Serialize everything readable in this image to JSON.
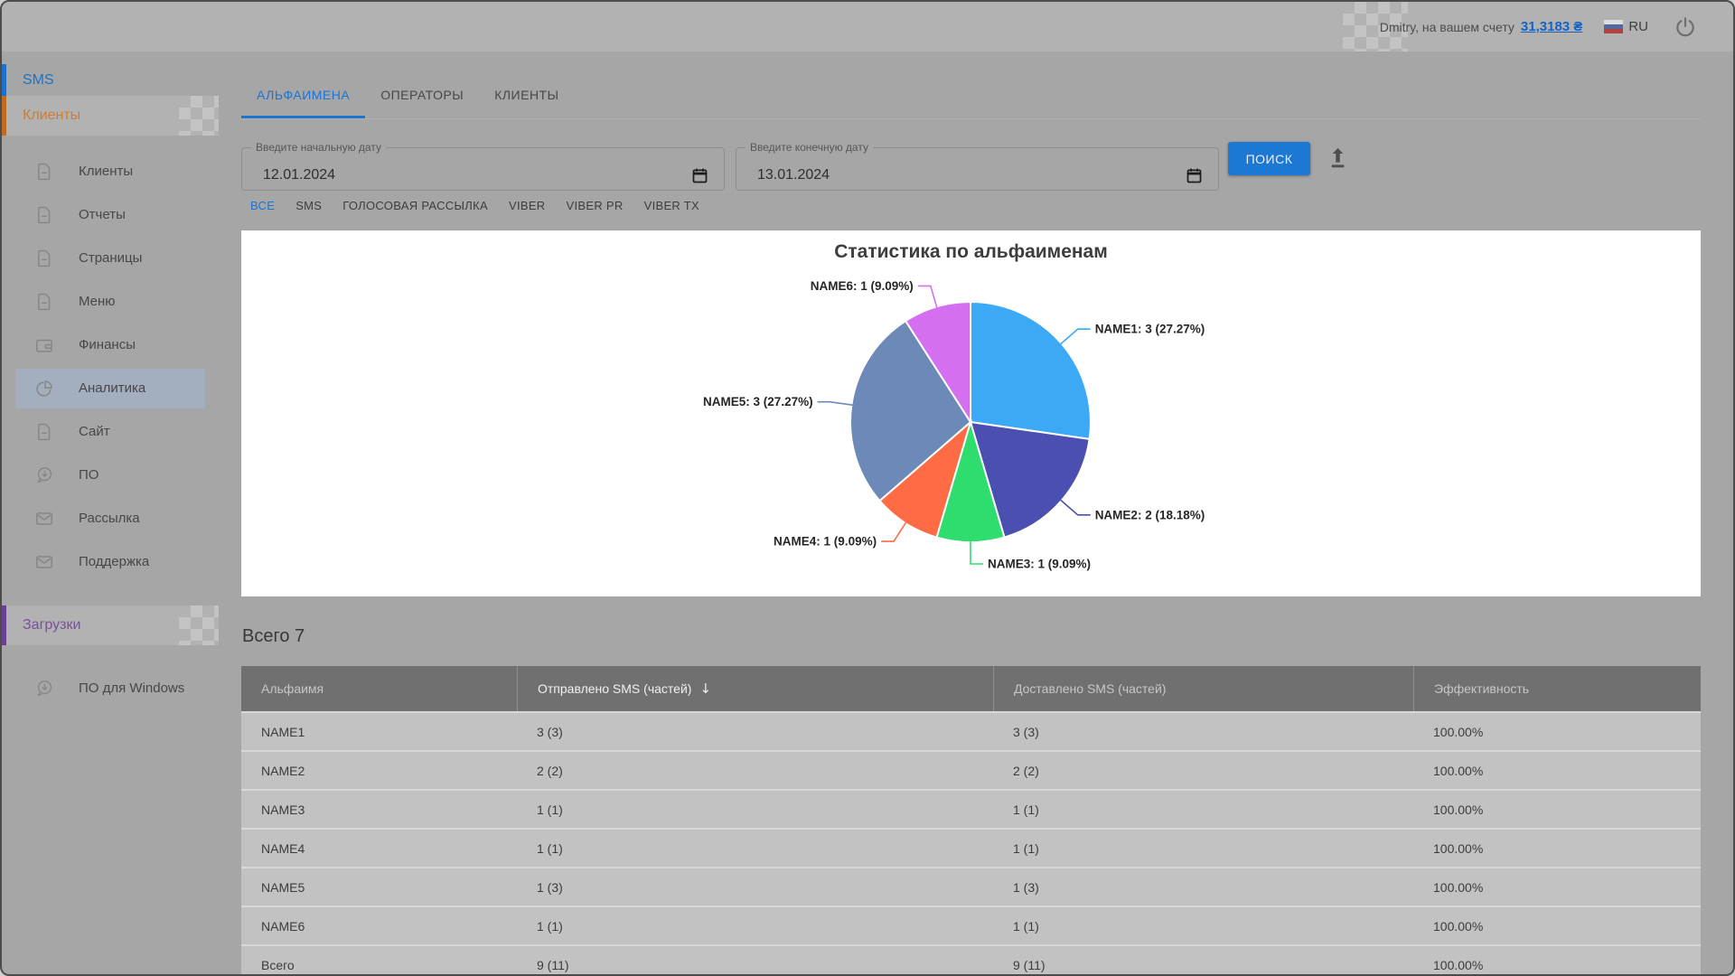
{
  "topbar": {
    "user_text": "Dmitry, на вашем счету",
    "balance": "31,3183 ₴",
    "lang": "RU"
  },
  "sidebar": {
    "sms_label": "SMS",
    "clients_label": "Клиенты",
    "downloads_label": "Загрузки",
    "items": [
      {
        "name": "clients",
        "label": "Клиенты",
        "icon": "document-icon",
        "active": false
      },
      {
        "name": "reports",
        "label": "Отчеты",
        "icon": "document-icon",
        "active": false
      },
      {
        "name": "pages",
        "label": "Страницы",
        "icon": "document-icon",
        "active": false
      },
      {
        "name": "menu",
        "label": "Меню",
        "icon": "document-icon",
        "active": false
      },
      {
        "name": "finances",
        "label": "Финансы",
        "icon": "wallet-icon",
        "active": false
      },
      {
        "name": "analytics",
        "label": "Аналитика",
        "icon": "pie-chart-icon",
        "active": true
      },
      {
        "name": "site",
        "label": "Сайт",
        "icon": "document-icon",
        "active": false
      },
      {
        "name": "software",
        "label": "ПО",
        "icon": "download-icon",
        "active": false
      },
      {
        "name": "mailing",
        "label": "Рассылка",
        "icon": "envelope-icon",
        "active": false
      },
      {
        "name": "support",
        "label": "Поддержка",
        "icon": "envelope-icon",
        "active": false
      }
    ],
    "downloads_items": [
      {
        "name": "software-windows",
        "label": "ПО для Windows",
        "icon": "download-icon",
        "active": false
      }
    ]
  },
  "tabs": [
    {
      "name": "alphanames",
      "label": "АЛЬФАИМЕНА",
      "active": true
    },
    {
      "name": "operators",
      "label": "ОПЕРАТОРЫ",
      "active": false
    },
    {
      "name": "clients",
      "label": "КЛИЕНТЫ",
      "active": false
    }
  ],
  "filters": {
    "start_date": {
      "label": "Введите начальную дату",
      "value": "12.01.2024"
    },
    "end_date": {
      "label": "Введите конечную дату",
      "value": "13.01.2024"
    },
    "search_button": "ПОИСК",
    "channels": [
      {
        "label": "ВСЕ",
        "active": true
      },
      {
        "label": "SMS",
        "active": false
      },
      {
        "label": "ГОЛОСОВАЯ РАССЫЛКА",
        "active": false
      },
      {
        "label": "VIBER",
        "active": false
      },
      {
        "label": "VIBER PR",
        "active": false
      },
      {
        "label": "VIBER TX",
        "active": false
      }
    ]
  },
  "chart_data": {
    "type": "pie",
    "title": "Статистика по альфаименам",
    "labels": [
      "NAME1",
      "NAME2",
      "NAME3",
      "NAME4",
      "NAME5",
      "NAME6"
    ],
    "values": [
      3,
      2,
      1,
      1,
      3,
      1
    ],
    "percents": [
      "27.27%",
      "18.18%",
      "9.09%",
      "9.09%",
      "27.27%",
      "9.09%"
    ],
    "colors": [
      "#3BA9F5",
      "#4B4FB0",
      "#2EDD6E",
      "#FF6B45",
      "#6C89B8",
      "#D46FEF"
    ],
    "legend_position": "none",
    "start_angle_deg": 0,
    "direction": "clockwise"
  },
  "summary": {
    "total_label": "Всего 7"
  },
  "table": {
    "headers": [
      "Альфаимя",
      "Отправлено SMS (частей)",
      "Доставлено SMS (частей)",
      "Эффективность"
    ],
    "sorted_index": 1,
    "sort_icon": "↓",
    "rows": [
      [
        "NAME1",
        "3 (3)",
        "3 (3)",
        "100.00%"
      ],
      [
        "NAME2",
        "2 (2)",
        "2 (2)",
        "100.00%"
      ],
      [
        "NAME3",
        "1 (1)",
        "1 (1)",
        "100.00%"
      ],
      [
        "NAME4",
        "1 (1)",
        "1 (1)",
        "100.00%"
      ],
      [
        "NAME5",
        "1 (3)",
        "1 (3)",
        "100.00%"
      ],
      [
        "NAME6",
        "1 (1)",
        "1 (1)",
        "100.00%"
      ]
    ],
    "footer_row": [
      "Всего",
      "9 (11)",
      "9 (11)",
      "100.00%"
    ]
  }
}
